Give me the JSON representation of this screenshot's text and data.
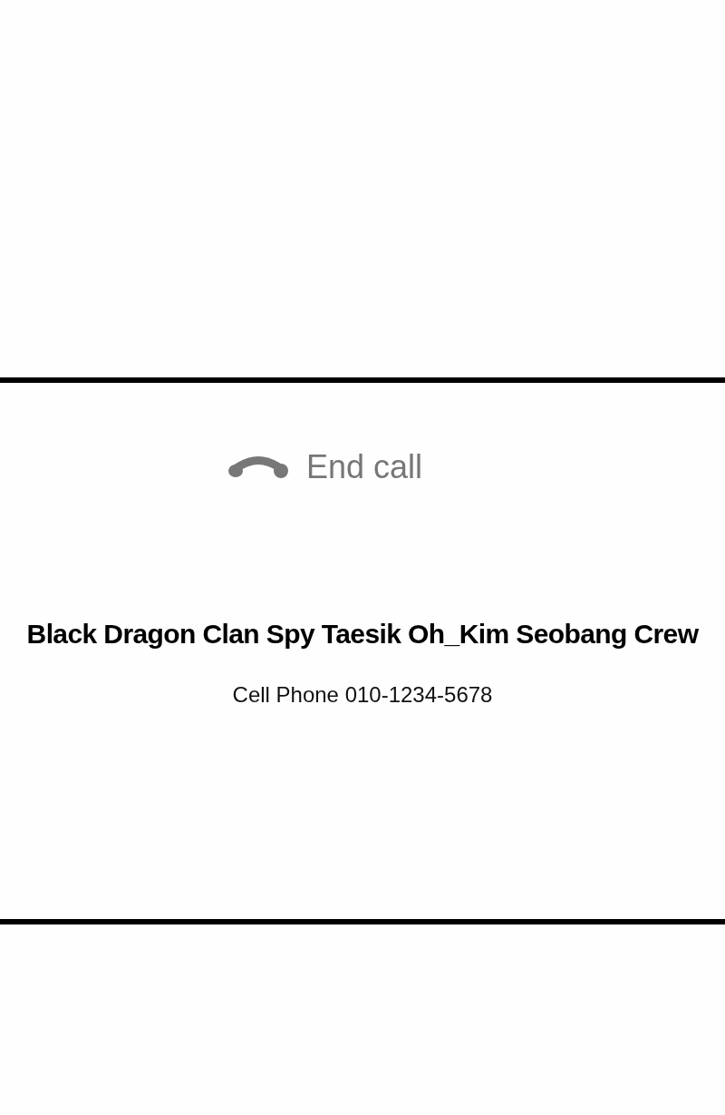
{
  "call_action": {
    "label": "End call"
  },
  "contact": {
    "name": "Black Dragon Clan Spy Taesik Oh_Kim Seobang Crew",
    "number": "Cell Phone 010-1234-5678"
  }
}
